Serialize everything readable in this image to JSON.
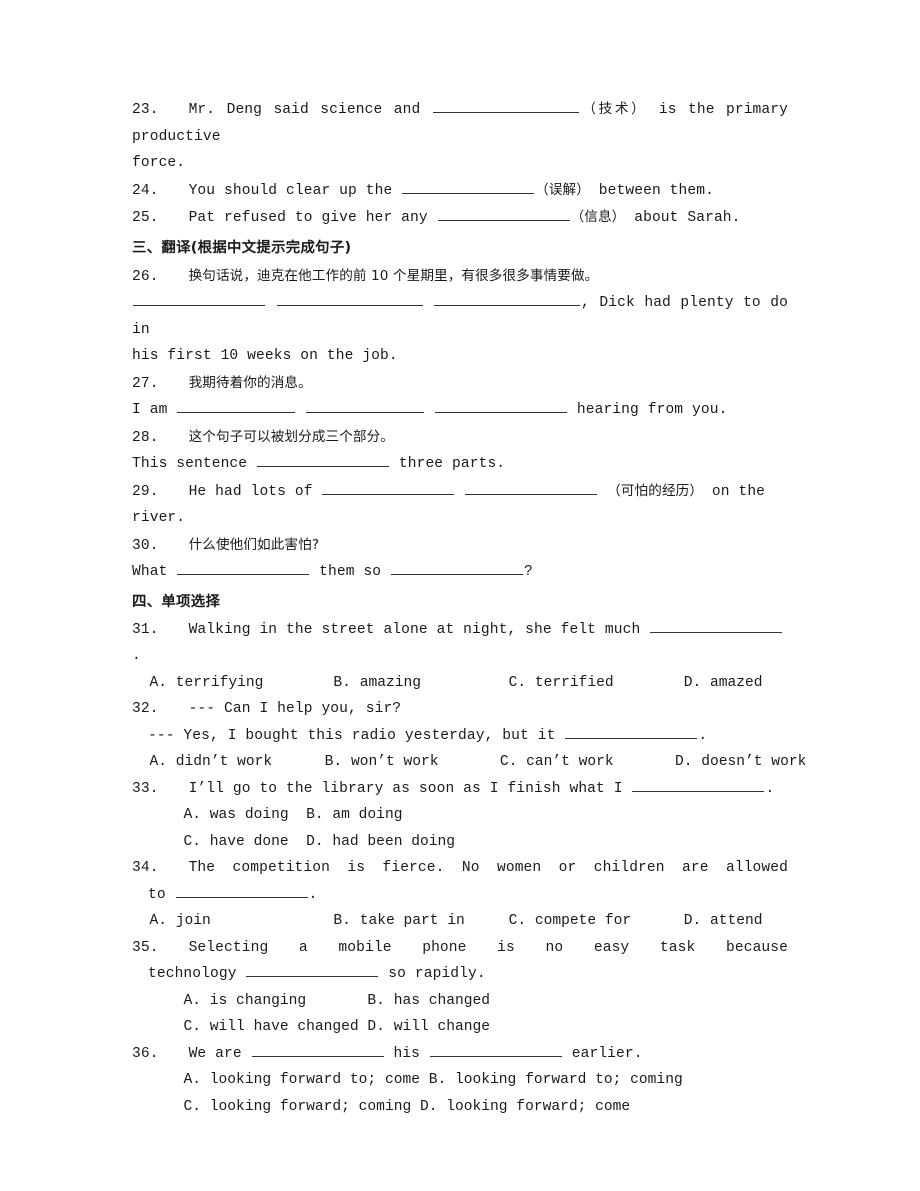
{
  "document": {
    "type": "english-exam-worksheet",
    "sections": [
      {
        "id": "fill-in-continued",
        "items": [
          {
            "number": "23.",
            "line1_a": "Mr. Deng said science and ",
            "hint": "（技术）",
            "line1_b": " is the primary productive",
            "line2": "force."
          },
          {
            "number": "24.",
            "text_a": "You should clear up the ",
            "hint": "（误解）",
            "text_b": " between them."
          },
          {
            "number": "25.",
            "text_a": "Pat refused to give her any ",
            "hint": "（信息）",
            "text_b": " about Sarah."
          }
        ]
      },
      {
        "id": "translation",
        "heading": "三、翻译(根据中文提示完成句子)",
        "items": [
          {
            "number": "26.",
            "chinese": "换句话说，迪克在他工作的前 10 个星期里，有很多很多事情要做。",
            "answer_line1_tail": ", Dick had plenty to do in",
            "answer_line2": "his first 10 weeks on the job."
          },
          {
            "number": "27.",
            "chinese": "我期待着你的消息。",
            "answer_lead": "I am ",
            "answer_tail": " hearing from you."
          },
          {
            "number": "28.",
            "chinese": "这个句子可以被划分成三个部分。",
            "answer_lead": "This sentence ",
            "answer_tail": " three parts."
          },
          {
            "number": "29.",
            "answer_lead": "He had lots of ",
            "hint": "（可怕的经历）",
            "answer_tail": " on the river."
          },
          {
            "number": "30.",
            "chinese": "什么使他们如此害怕?",
            "answer_lead": "What ",
            "answer_mid": " them so ",
            "answer_tail": "?"
          }
        ]
      },
      {
        "id": "multiple-choice",
        "heading": "四、单项选择",
        "items": [
          {
            "number": "31.",
            "stem_a": "Walking in the street alone at night, she felt much ",
            "stem_b": ".",
            "option_rows": [
              "  A. terrifying        B. amazing          C. terrified        D. amazed"
            ]
          },
          {
            "number": "32.",
            "stem_line1": "--- Can I help you, sir?",
            "stem_line2_a": "--- Yes, I bought this radio yesterday, but it ",
            "stem_line2_b": ".",
            "option_rows": [
              "  A. didn’t work      B. won’t work       C. can’t work       D. doesn’t work"
            ]
          },
          {
            "number": "33.",
            "stem_a": "I’ll go to the library as soon as I finish what I ",
            "stem_b": ".",
            "option_rows": [
              "  A. was doing  B. am doing",
              "  C. have done  D. had been doing"
            ]
          },
          {
            "number": "34.",
            "stem_a": "The competition is fierce. No women or children are allowed",
            "stem_line2_lead": "to ",
            "stem_line2_tail": ".",
            "option_rows": [
              "  A. join              B. take part in     C. compete for      D. attend"
            ]
          },
          {
            "number": "35.",
            "stem_a": "Selecting a mobile phone is no easy task because",
            "stem_line2_lead": "technology ",
            "stem_line2_tail": " so rapidly.",
            "option_rows": [
              "  A. is changing       B. has changed",
              "  C. will have changed D. will change"
            ]
          },
          {
            "number": "36.",
            "stem_lead": "We are ",
            "stem_mid": " his ",
            "stem_tail": " earlier.",
            "option_rows": [
              "  A. looking forward to; come B. looking forward to; coming",
              "  C. looking forward; coming D. looking forward; come"
            ]
          }
        ]
      }
    ]
  }
}
